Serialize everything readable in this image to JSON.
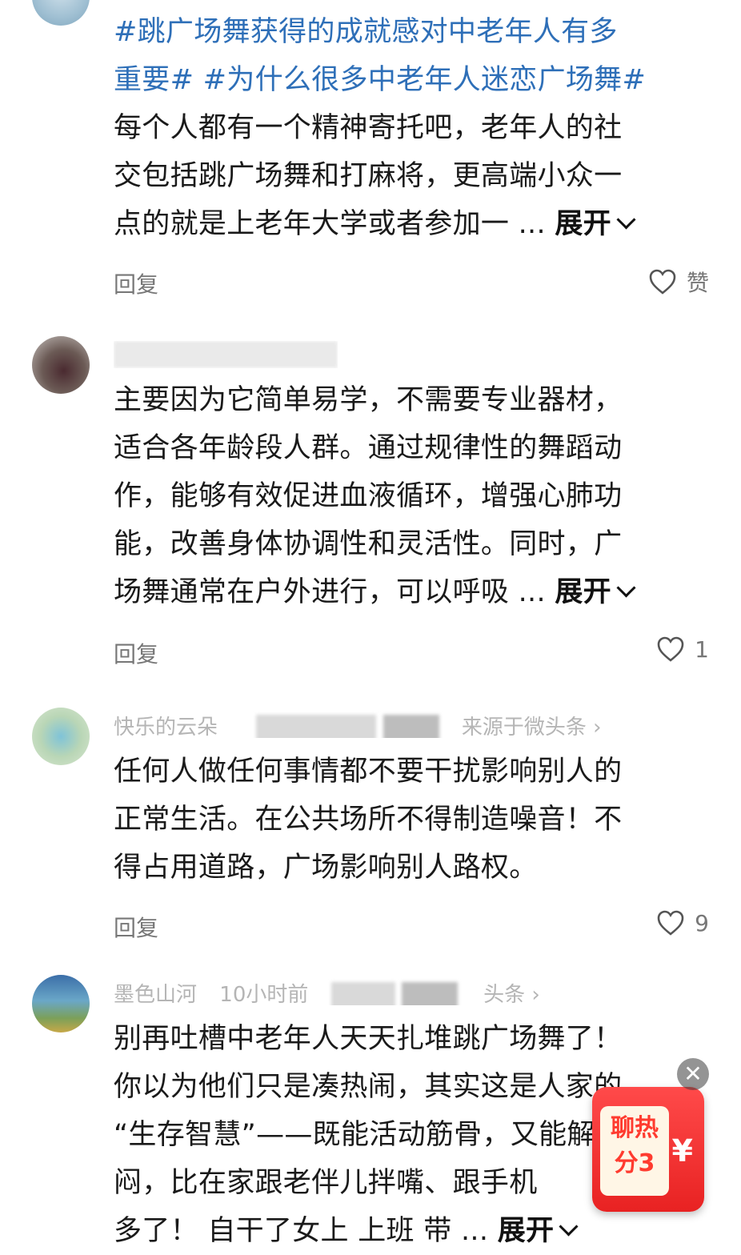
{
  "comments": [
    {
      "lines_tags": [
        "#跳广场舞获得的成就感对中老年人有多",
        "重要# #为什么很多中老年人迷恋广场舞#"
      ],
      "lines": [
        "每个人都有一个精神寄托吧，老年人的社",
        "交包括跳广场舞和打麻将，更高端小众一",
        "点的就是上老年大学或者参加一 ..."
      ],
      "expand_label": "展开",
      "reply_label": "回复",
      "like_label": "赞"
    },
    {
      "lines": [
        "主要因为它简单易学，不需要专业器材，",
        "适合各年龄段人群。通过规律性的舞蹈动",
        "作，能够有效促进血液循环，增强心肺功",
        "能，改善身体协调性和灵活性。同时，广",
        "场舞通常在户外进行，可以呼吸 ..."
      ],
      "expand_label": "展开",
      "reply_label": "回复",
      "like_count": "1"
    },
    {
      "meta_user": "快乐的云朵",
      "meta_source": "来源于微头条 ›",
      "lines": [
        "任何人做任何事情都不要干扰影响别人的",
        "正常生活。在公共场所不得制造噪音！不",
        "得占用道路，广场影响别人路权。"
      ],
      "reply_label": "回复",
      "like_count": "9"
    },
    {
      "meta_user": "墨色山河",
      "meta_time": "10小时前",
      "meta_source": "头条 ›",
      "lines": [
        "别再吐槽中老年人天天扎堆跳广场舞了！",
        "你以为他们只是凑热闹，其实这是人家的",
        "“生存智慧”——既能活动筋骨，又能解",
        "闷，比在家跟老伴儿拌嘴、跟手机",
        "多了！ 自干了女上 上班 带 ..."
      ],
      "expand_label": "展开"
    }
  ],
  "float_widget": {
    "line1": "聊热",
    "line2": "分3",
    "currency": "¥",
    "close": "✕"
  }
}
